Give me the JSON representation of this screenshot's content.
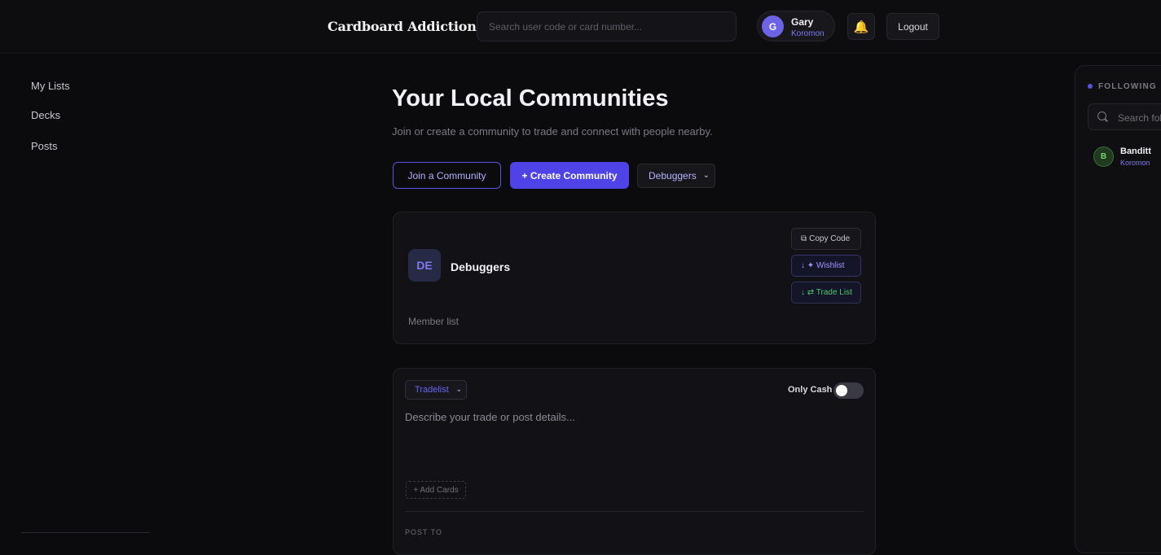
{
  "header": {
    "brand": "Cardboard Addiction",
    "search_placeholder": "Search user code or card number...",
    "user": {
      "initial": "G",
      "name": "Gary",
      "game": "Koromon"
    },
    "bell_icon": "bell-icon",
    "logout_label": "Logout"
  },
  "sidebar": {
    "items": [
      {
        "label": "My Lists"
      },
      {
        "label": "Decks"
      },
      {
        "label": "Posts"
      }
    ]
  },
  "main": {
    "title": "Your Local Communities",
    "subtitle": "Join or create a community to trade and connect with people nearby.",
    "join_label": "Join a Community",
    "create_label": "+ Create Community",
    "selected_community": "Debuggers",
    "community": {
      "initials": "DE",
      "name": "Debuggers",
      "copy_label": "Copy Code",
      "wishlist_label": "↓ ✦ Wishlist",
      "tradelist_label": "↓ ⇄ Trade List",
      "member_list_label": "Member list"
    },
    "post": {
      "list_type": "Tradelist",
      "only_cash_label": "Only Cash",
      "only_cash": false,
      "placeholder": "Describe your trade or post details...",
      "add_cards_label": "+ Add Cards",
      "post_to_label": "POST TO"
    }
  },
  "following": {
    "title": "FOLLOWING",
    "search_placeholder": "Search following",
    "users": [
      {
        "initial": "B",
        "name": "Banditt",
        "game": "Koromon"
      }
    ]
  },
  "colors": {
    "accent": "#4d43e6",
    "accent_text": "#7f79f0",
    "trade_green": "#49c96a",
    "background": "#0b0b0d"
  }
}
